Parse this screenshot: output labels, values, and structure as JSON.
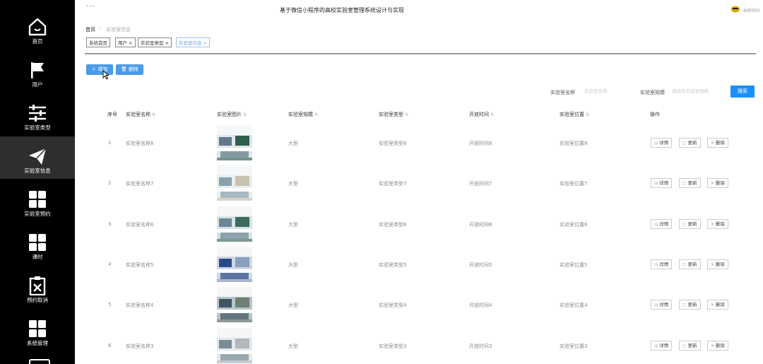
{
  "app": {
    "title": "基于微信小程序的高校实验室管理系统设计与实现",
    "user": "admin",
    "menu_dots": "···"
  },
  "sidebar": {
    "items": [
      {
        "label": "首页",
        "icon": "home-icon"
      },
      {
        "label": "用户",
        "icon": "flag-icon"
      },
      {
        "label": "实验室类型",
        "icon": "sliders-icon"
      },
      {
        "label": "实验室信息",
        "icon": "paper-plane-icon",
        "active": true
      },
      {
        "label": "实验室预约",
        "icon": "grid-icon"
      },
      {
        "label": "课时",
        "icon": "grid-icon"
      },
      {
        "label": "预约取消",
        "icon": "clipboard-x-icon"
      },
      {
        "label": "系统管理",
        "icon": "grid-icon"
      }
    ]
  },
  "breadcrumb": {
    "home": "首页",
    "sep": "/",
    "current": "实验室信息"
  },
  "tags": [
    "系统首页",
    "用户 ×",
    "实验室类型 ×",
    "实验室信息 ×"
  ],
  "toolbar": {
    "add": "＋ 增加",
    "delete": "🗑 删除"
  },
  "search": {
    "name_label": "实验室名称",
    "name_placeholder": "实验室名称",
    "scale_label": "实验室规模",
    "scale_placeholder": "请选择实验室规模",
    "button": "搜索"
  },
  "table": {
    "headers": [
      "序号",
      "实验室名称",
      "实验室图片",
      "实验室规模",
      "实验室类型",
      "开放时间",
      "实验室位置",
      "操作"
    ],
    "actions": {
      "detail": "详情",
      "update": "更新",
      "delete": "删除"
    },
    "rows": [
      {
        "no": "1",
        "name": "实验室名称8",
        "scale": "大型",
        "type": "实验室类型8",
        "time": "开放时间8",
        "location": "实验室位置8"
      },
      {
        "no": "2",
        "name": "实验室名称7",
        "scale": "大型",
        "type": "实验室类型7",
        "time": "开放时间7",
        "location": "实验室位置7"
      },
      {
        "no": "3",
        "name": "实验室名称6",
        "scale": "大型",
        "type": "实验室类型6",
        "time": "开放时间6",
        "location": "实验室位置6"
      },
      {
        "no": "4",
        "name": "实验室名称5",
        "scale": "大型",
        "type": "实验室类型5",
        "time": "开放时间5",
        "location": "实验室位置5"
      },
      {
        "no": "5",
        "name": "实验室名称4",
        "scale": "大型",
        "type": "实验室类型4",
        "time": "开放时间4",
        "location": "实验室位置4"
      },
      {
        "no": "6",
        "name": "实验室名称3",
        "scale": "大型",
        "type": "实验室类型3",
        "time": "开放时间3",
        "location": "实验室位置3"
      }
    ]
  },
  "colors": {
    "sidebar": "#000000",
    "sidebar_active": "#2e2e2e",
    "primary": "#1890ff",
    "button": "#4a9be8"
  }
}
